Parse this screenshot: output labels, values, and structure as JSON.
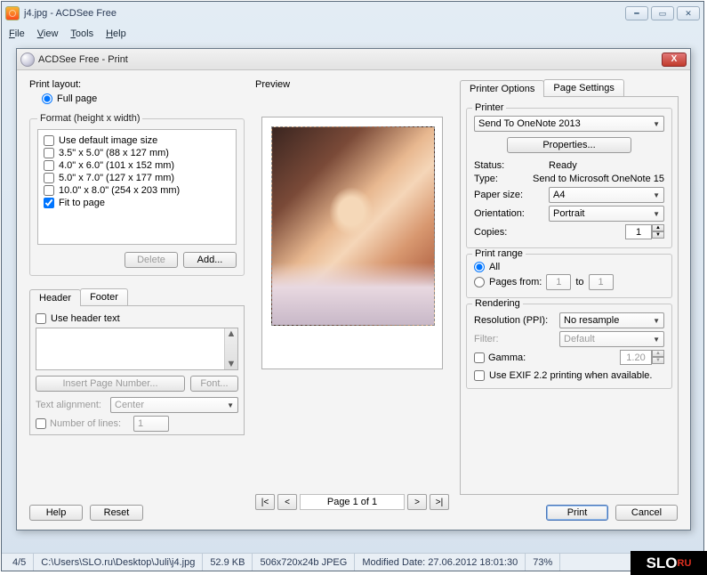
{
  "window": {
    "title": "j4.jpg - ACDSee Free"
  },
  "menubar": {
    "file": "File",
    "view": "View",
    "tools": "Tools",
    "help": "Help"
  },
  "dialog": {
    "title": "ACDSee Free - Print"
  },
  "layout": {
    "label": "Print layout:",
    "full_page": "Full page"
  },
  "format": {
    "legend": "Format (height x width)",
    "items": [
      "Use default image size",
      "3.5\" x 5.0\" (88 x 127 mm)",
      "4.0\" x 6.0\" (101 x 152 mm)",
      "5.0\" x 7.0\" (127 x 177 mm)",
      "10.0\" x 8.0\" (254 x 203 mm)",
      "Fit to page"
    ],
    "delete_btn": "Delete",
    "add_btn": "Add..."
  },
  "hf": {
    "tab_header": "Header",
    "tab_footer": "Footer",
    "use_header": "Use header text",
    "insert_pn": "Insert Page Number...",
    "font_btn": "Font...",
    "align_label": "Text alignment:",
    "align_value": "Center",
    "lines_label": "Number of lines:",
    "lines_value": "1"
  },
  "preview": {
    "label": "Preview",
    "page_info": "Page 1 of 1"
  },
  "options": {
    "tab_printer": "Printer Options",
    "tab_page": "Page Settings",
    "printer_lgnd": "Printer",
    "printer_name": "Send To OneNote 2013",
    "properties_btn": "Properties...",
    "status_label": "Status:",
    "status_value": "Ready",
    "type_label": "Type:",
    "type_value": "Send to Microsoft OneNote 15",
    "papersize_label": "Paper size:",
    "papersize_value": "A4",
    "orientation_label": "Orientation:",
    "orientation_value": "Portrait",
    "copies_label": "Copies:",
    "copies_value": "1",
    "range_lgnd": "Print range",
    "range_all": "All",
    "range_pages": "Pages from:",
    "range_from": "1",
    "range_to_label": "to",
    "range_to": "1",
    "render_lgnd": "Rendering",
    "res_label": "Resolution (PPI):",
    "res_value": "No resample",
    "filter_label": "Filter:",
    "filter_value": "Default",
    "gamma_label": "Gamma:",
    "gamma_value": "1.20",
    "exif_label": "Use EXIF 2.2 printing when available."
  },
  "buttons": {
    "help": "Help",
    "reset": "Reset",
    "print": "Print",
    "cancel": "Cancel"
  },
  "statusbar": {
    "index": "4/5",
    "path": "C:\\Users\\SLO.ru\\Desktop\\Juli\\j4.jpg",
    "size": "52.9 KB",
    "dims": "506x720x24b JPEG",
    "modified": "Modified Date: 27.06.2012 18:01:30",
    "zoom": "73%"
  }
}
